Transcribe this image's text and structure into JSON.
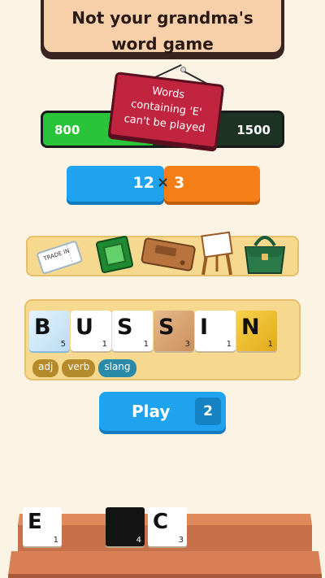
{
  "banner": {
    "line1": "Not your grandma's",
    "line2": "word game"
  },
  "rule_sign": {
    "line1": "Words",
    "line2": "containing 'E'",
    "line3": "can't be played"
  },
  "progress": {
    "current": "800",
    "target": "1500",
    "fill_fraction": 0.46
  },
  "score": {
    "chips": "12",
    "multiplier": "3",
    "operator": "×"
  },
  "items": [
    {
      "name": "trade-in-ticket",
      "label": "TRADE IN"
    },
    {
      "name": "green-chip"
    },
    {
      "name": "wooden-tray"
    },
    {
      "name": "easel"
    },
    {
      "name": "green-handbag"
    }
  ],
  "word_tiles": [
    {
      "letter": "B",
      "points": "5",
      "style": "ice"
    },
    {
      "letter": "U",
      "points": "1",
      "style": "plain"
    },
    {
      "letter": "S",
      "points": "1",
      "style": "plain"
    },
    {
      "letter": "S",
      "points": "3",
      "style": "wood"
    },
    {
      "letter": "I",
      "points": "1",
      "style": "plain"
    },
    {
      "letter": "N",
      "points": "1",
      "style": "gold"
    }
  ],
  "tags": [
    {
      "label": "adj",
      "color": "#b58a2a"
    },
    {
      "label": "verb",
      "color": "#b58a2a"
    },
    {
      "label": "slang",
      "color": "#2a8aa8"
    }
  ],
  "play": {
    "label": "Play",
    "count": "2"
  },
  "rack_tiles": [
    {
      "letter": "E",
      "points": "1",
      "style": "plain"
    },
    {
      "letter": "",
      "points": "4",
      "style": "dark"
    },
    {
      "letter": "C",
      "points": "3",
      "style": "plain"
    }
  ],
  "colors": {
    "accent_blue": "#1fa3ef",
    "accent_orange": "#f57f16",
    "sign_red": "#c0243e",
    "progress_green": "#29c43a"
  }
}
